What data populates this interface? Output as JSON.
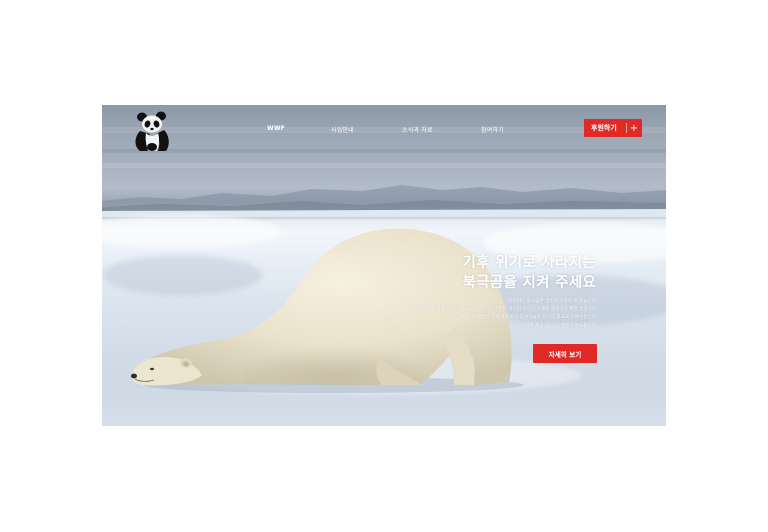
{
  "header": {
    "nav": [
      {
        "label": "WWF"
      },
      {
        "label": "사업안내"
      },
      {
        "label": "소식과 자료"
      },
      {
        "label": "참여하기"
      }
    ],
    "donate_label": "후원하기",
    "donate_icon": "plus-icon"
  },
  "hero": {
    "headline_line1": "기후 위기로 사라지는",
    "headline_line2": "북극곰을 지켜 주세요",
    "description": [
      "2050년, 북극곰은 굶주려 사라질 수 있습니다",
      "기후위기를 대처하는 일은 북극곰을 지키는 것 뿐만 아니라 우리의 문제를 해결하기 위한 일입니다",
      "WWF의 활동은 전세계 600만 후원자들과 당신의 참교육 이루어집니다",
      "바로 지금, 당신의 행동이 필요합니다"
    ],
    "more_label": "자세히 보기"
  },
  "colors": {
    "accent": "#e12a26",
    "text_on_image": "#ffffff"
  }
}
